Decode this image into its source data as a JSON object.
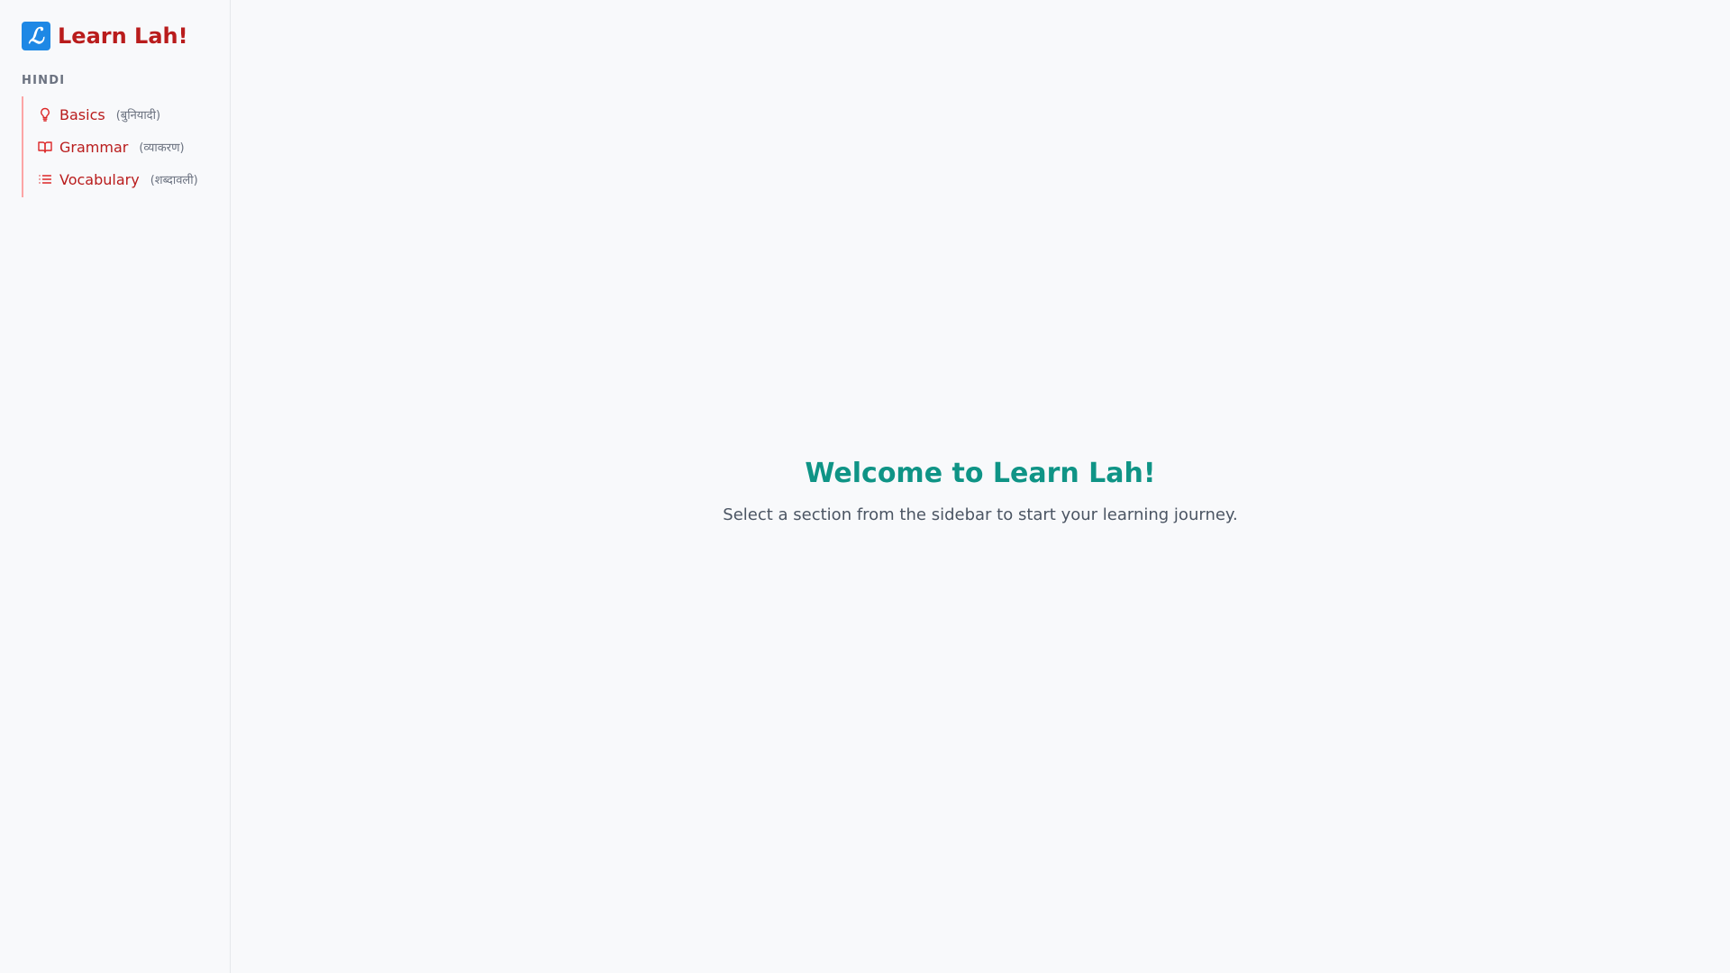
{
  "app": {
    "logo_glyph": "ℒ",
    "name": "Learn Lah!"
  },
  "sidebar": {
    "section_title": "HINDI",
    "items": [
      {
        "label": "Basics",
        "native": "(बुनियादी)",
        "icon": "lightbulb-icon"
      },
      {
        "label": "Grammar",
        "native": "(व्याकरण)",
        "icon": "book-open-icon"
      },
      {
        "label": "Vocabulary",
        "native": "(शब्दावली)",
        "icon": "list-icon"
      }
    ]
  },
  "main": {
    "title": "Welcome to Learn Lah!",
    "subtitle": "Select a section from the sidebar to start your learning journey."
  },
  "colors": {
    "brand_red": "#b91c1c",
    "teal_title": "#0f9486",
    "logo_blue": "#1e88e5"
  }
}
